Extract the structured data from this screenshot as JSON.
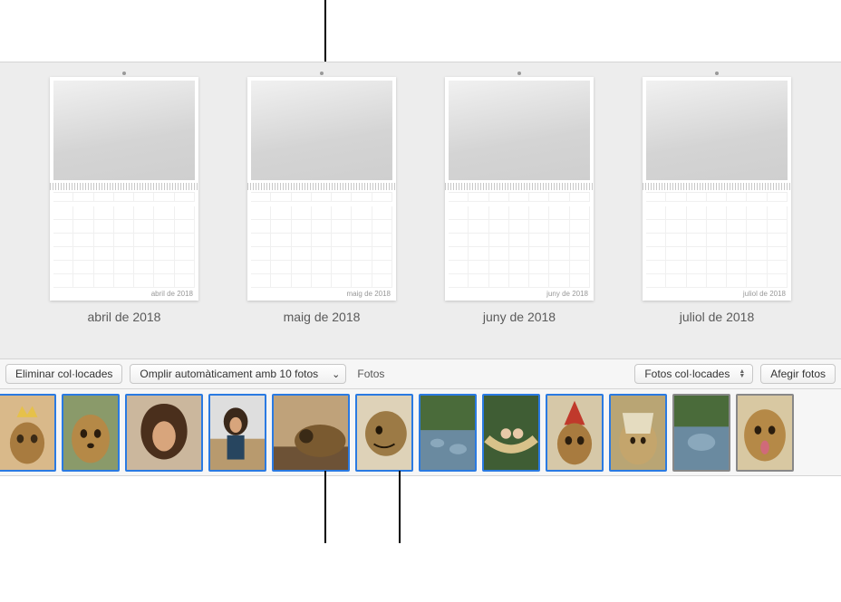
{
  "months": [
    {
      "label": "abril de 2018",
      "footer": "abril de 2018"
    },
    {
      "label": "maig de 2018",
      "footer": "maig de 2018"
    },
    {
      "label": "juny de 2018",
      "footer": "juny de 2018"
    },
    {
      "label": "juliol de 2018",
      "footer": "juliol de 2018"
    }
  ],
  "toolbar": {
    "clear_placed": "Eliminar col·locades",
    "autofill": "Omplir automàticament amb 10 fotos",
    "photos_label": "Fotos",
    "select_value": "Fotos col·locades",
    "add_photos": "Afegir fotos"
  },
  "thumbs": [
    {
      "w": 64,
      "selected": true,
      "kind": "dog-crown"
    },
    {
      "w": 64,
      "selected": true,
      "kind": "dog"
    },
    {
      "w": 86,
      "selected": true,
      "kind": "woman-curly"
    },
    {
      "w": 64,
      "selected": true,
      "kind": "woman-sit"
    },
    {
      "w": 86,
      "selected": true,
      "kind": "dog-rest"
    },
    {
      "w": 64,
      "selected": true,
      "kind": "dog-side"
    },
    {
      "w": 64,
      "selected": true,
      "kind": "river"
    },
    {
      "w": 64,
      "selected": true,
      "kind": "kids-hammock"
    },
    {
      "w": 64,
      "selected": true,
      "kind": "dog-hat"
    },
    {
      "w": 64,
      "selected": true,
      "kind": "dog-paper"
    },
    {
      "w": 64,
      "selected": false,
      "kind": "river2"
    },
    {
      "w": 64,
      "selected": false,
      "kind": "dog-tongue"
    }
  ]
}
